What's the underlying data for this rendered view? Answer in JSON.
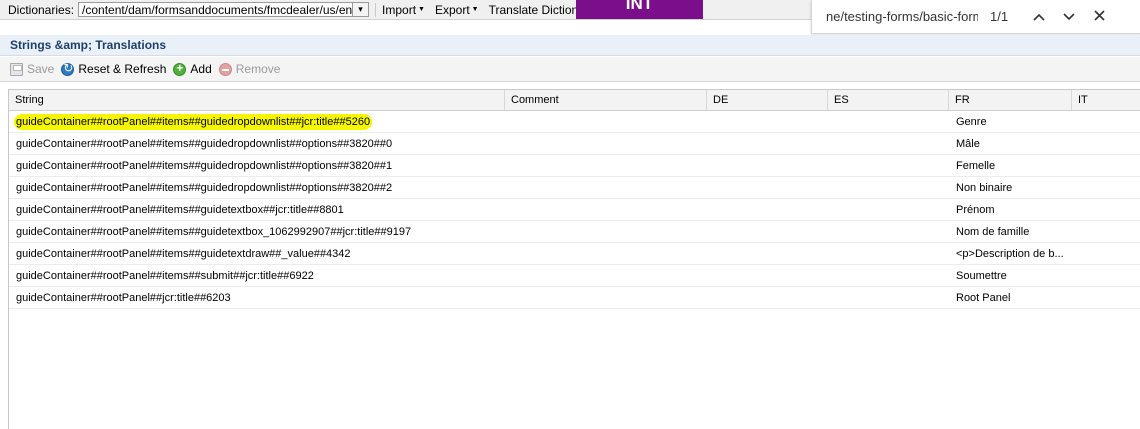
{
  "topbar": {
    "dictionaries_label": "Dictionaries:",
    "path_value": "/content/dam/formsanddocuments/fmcdealer/us/en/",
    "dropdown_glyph": "▾",
    "import_label": "Import",
    "export_label": "Export",
    "translate_label": "Translate Dictionary",
    "int_badge": "INT",
    "int_color": "#7b0f8b"
  },
  "findbar": {
    "query": "ne/testing-forms/basic-form",
    "count": "1/1",
    "prev_glyph": "⌃",
    "next_glyph": "⌄",
    "close_glyph": "✕"
  },
  "panel": {
    "title": "Strings &amp; Translations",
    "toolbar": {
      "save_label": "Save",
      "reset_label": "Reset & Refresh",
      "add_label": "Add",
      "remove_label": "Remove"
    }
  },
  "grid": {
    "columns": [
      "String",
      "Comment",
      "DE",
      "ES",
      "FR",
      "IT"
    ],
    "rows": [
      {
        "string": "guideContainer##rootPanel##items##guidedropdownlist##jcr:title##5260",
        "comment": "",
        "de": "",
        "es": "",
        "fr": "Genre",
        "it": ""
      },
      {
        "string": "guideContainer##rootPanel##items##guidedropdownlist##options##3820##0",
        "comment": "",
        "de": "",
        "es": "",
        "fr": "Mâle",
        "it": ""
      },
      {
        "string": "guideContainer##rootPanel##items##guidedropdownlist##options##3820##1",
        "comment": "",
        "de": "",
        "es": "",
        "fr": "Femelle",
        "it": ""
      },
      {
        "string": "guideContainer##rootPanel##items##guidedropdownlist##options##3820##2",
        "comment": "",
        "de": "",
        "es": "",
        "fr": "Non binaire",
        "it": ""
      },
      {
        "string": "guideContainer##rootPanel##items##guidetextbox##jcr:title##8801",
        "comment": "",
        "de": "",
        "es": "",
        "fr": "Prénom",
        "it": ""
      },
      {
        "string": "guideContainer##rootPanel##items##guidetextbox_1062992907##jcr:title##9197",
        "comment": "",
        "de": "",
        "es": "",
        "fr": "Nom de famille",
        "it": ""
      },
      {
        "string": "guideContainer##rootPanel##items##guidetextdraw##_value##4342",
        "comment": "",
        "de": "",
        "es": "",
        "fr": "<p>Description de b...",
        "it": ""
      },
      {
        "string": "guideContainer##rootPanel##items##submit##jcr:title##6922",
        "comment": "",
        "de": "",
        "es": "",
        "fr": "Soumettre",
        "it": ""
      },
      {
        "string": "guideContainer##rootPanel##jcr:title##6203",
        "comment": "",
        "de": "",
        "es": "",
        "fr": "Root Panel",
        "it": ""
      }
    ],
    "highlight_color": "#f6f600"
  }
}
